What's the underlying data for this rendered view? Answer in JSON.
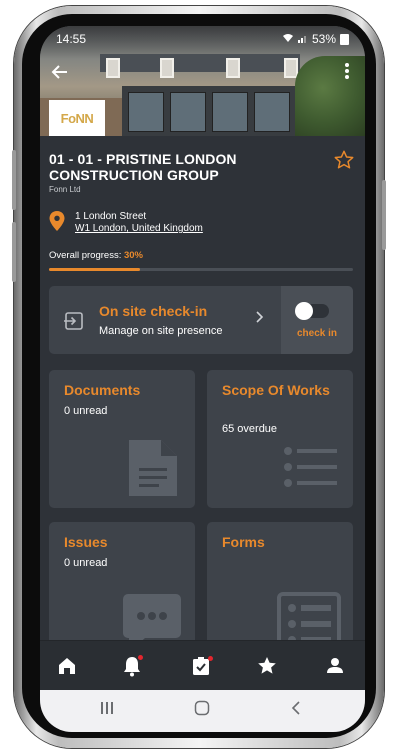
{
  "status_bar": {
    "time": "14:55",
    "battery": "53%"
  },
  "project": {
    "logo_text": "FONN",
    "title": "01 - 01 - PRISTINE LONDON CONSTRUCTION GROUP",
    "company": "Fonn Ltd",
    "address_line1": "1 London Street",
    "address_line2": "W1 London, United Kingdom",
    "progress_label": "Overall progress:",
    "progress_value": "30%",
    "progress_fraction": 0.3
  },
  "checkin": {
    "title": "On site check-in",
    "subtitle": "Manage on site presence",
    "toggle_label": "check in"
  },
  "tiles": [
    {
      "title": "Documents",
      "subtitle": "0 unread",
      "icon": "document-icon"
    },
    {
      "title": "Scope Of Works",
      "subtitle": "65 overdue",
      "icon": "list-icon"
    },
    {
      "title": "Issues",
      "subtitle": "0 unread",
      "icon": "chat-icon"
    },
    {
      "title": "Forms",
      "subtitle": "",
      "icon": "form-icon"
    }
  ],
  "bottom_nav": [
    {
      "icon": "home-icon"
    },
    {
      "icon": "bell-icon"
    },
    {
      "icon": "clipboard-check-icon"
    },
    {
      "icon": "star-icon"
    },
    {
      "icon": "person-icon"
    }
  ],
  "colors": {
    "accent": "#e8892c",
    "background": "#2e3238",
    "card": "#3e434a",
    "notification": "#e3262e"
  }
}
